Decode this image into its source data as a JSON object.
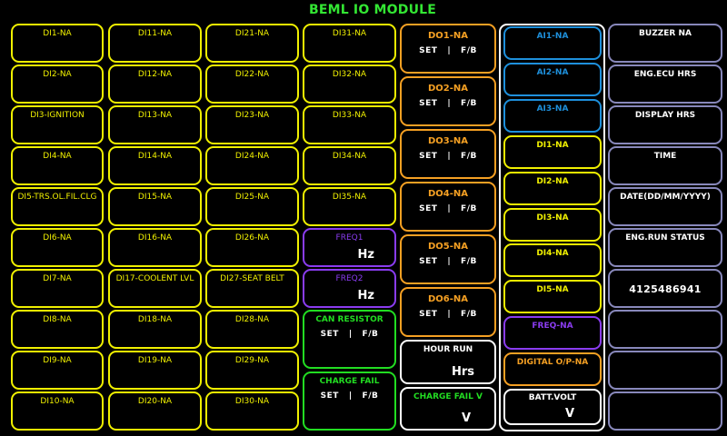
{
  "title": "BEML IO MODULE",
  "di_col1": [
    "DI1-NA",
    "DI2-NA",
    "DI3-IGNITION",
    "DI4-NA",
    "DI5-TRS.OL.FIL.CLG",
    "DI6-NA",
    "DI7-NA",
    "DI8-NA",
    "DI9-NA",
    "DI10-NA"
  ],
  "di_col2": [
    "DI11-NA",
    "DI12-NA",
    "DI13-NA",
    "DI14-NA",
    "DI15-NA",
    "DI16-NA",
    "DI17-COOLENT LVL",
    "DI18-NA",
    "DI19-NA",
    "DI20-NA"
  ],
  "di_col3": [
    "DI21-NA",
    "DI22-NA",
    "DI23-NA",
    "DI24-NA",
    "DI25-NA",
    "DI26-NA",
    "DI27-SEAT BELT",
    "DI28-NA",
    "DI29-NA",
    "DI30-NA"
  ],
  "di_col4": [
    "DI31-NA",
    "DI32-NA",
    "DI33-NA",
    "DI34-NA",
    "DI35-NA"
  ],
  "freq": [
    {
      "label": "FREQ1",
      "unit": "Hz"
    },
    {
      "label": "FREQ2",
      "unit": "Hz"
    }
  ],
  "can_resistor": {
    "label": "CAN RESISTOR",
    "set": "SET",
    "sep": "|",
    "fb": "F/B"
  },
  "charge_fail": {
    "label": "CHARGE FAIL",
    "set": "SET",
    "sep": "|",
    "fb": "F/B"
  },
  "do_items": [
    {
      "label": "DO1-NA",
      "set": "SET",
      "sep": "|",
      "fb": "F/B"
    },
    {
      "label": "DO2-NA",
      "set": "SET",
      "sep": "|",
      "fb": "F/B"
    },
    {
      "label": "DO3-NA",
      "set": "SET",
      "sep": "|",
      "fb": "F/B"
    },
    {
      "label": "DO4-NA",
      "set": "SET",
      "sep": "|",
      "fb": "F/B"
    },
    {
      "label": "DO5-NA",
      "set": "SET",
      "sep": "|",
      "fb": "F/B"
    },
    {
      "label": "DO6-NA",
      "set": "SET",
      "sep": "|",
      "fb": "F/B"
    }
  ],
  "hour_run": {
    "label": "HOUR RUN",
    "unit": "Hrs"
  },
  "charge_fail_v": {
    "label": "CHARGE FAIL V",
    "unit": "V"
  },
  "ai_items": [
    "AI1-NA",
    "AI2-NA",
    "AI3-NA"
  ],
  "di_panel": [
    "DI1-NA",
    "DI2-NA",
    "DI3-NA",
    "DI4-NA",
    "DI5-NA"
  ],
  "freq_na": "FREQ-NA",
  "digital_op": "DIGITAL O/P-NA",
  "batt_volt": {
    "label": "BATT.VOLT",
    "unit": "V"
  },
  "status": {
    "buzzer": "BUZZER NA",
    "eng_ecu_hrs": "ENG.ECU HRS",
    "display_hrs": "DISPLAY HRS",
    "time": "TIME",
    "date": "DATE(DD/MM/YYYY)",
    "eng_run_status": "ENG.RUN STATUS",
    "phone": "4125486941"
  }
}
